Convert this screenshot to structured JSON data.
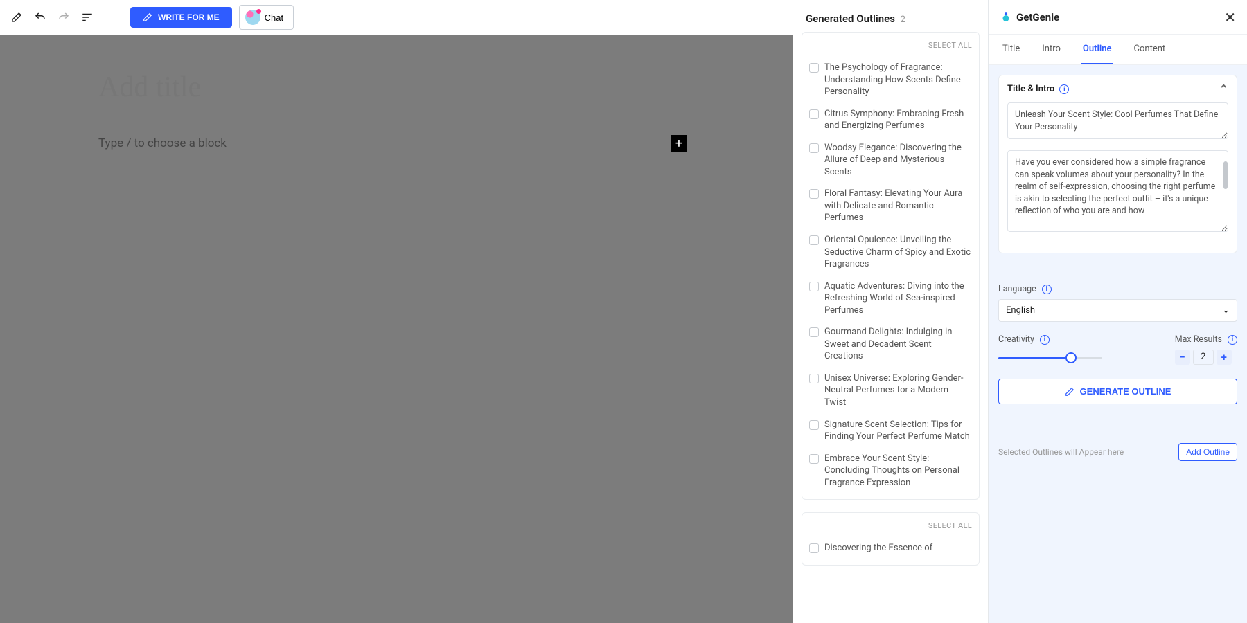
{
  "toolbar": {
    "write_label": "WRITE FOR ME",
    "chat_label": "Chat"
  },
  "editor": {
    "title_placeholder": "Add title",
    "block_placeholder": "Type / to choose a block"
  },
  "outlines_panel": {
    "heading": "Generated Outlines",
    "count": "2",
    "select_all": "SELECT ALL",
    "groups": [
      {
        "items": [
          "The Psychology of Fragrance: Understanding How Scents Define Personality",
          "Citrus Symphony: Embracing Fresh and Energizing Perfumes",
          "Woodsy Elegance: Discovering the Allure of Deep and Mysterious Scents",
          "Floral Fantasy: Elevating Your Aura with Delicate and Romantic Perfumes",
          "Oriental Opulence: Unveiling the Seductive Charm of Spicy and Exotic Fragrances",
          "Aquatic Adventures: Diving into the Refreshing World of Sea-inspired Perfumes",
          "Gourmand Delights: Indulging in Sweet and Decadent Scent Creations",
          "Unisex Universe: Exploring Gender-Neutral Perfumes for a Modern Twist",
          "Signature Scent Selection: Tips for Finding Your Perfect Perfume Match",
          "Embrace Your Scent Style: Concluding Thoughts on Personal Fragrance Expression"
        ]
      },
      {
        "items": [
          "Discovering the Essence of"
        ]
      }
    ]
  },
  "right_panel": {
    "brand": "GetGenie",
    "tabs": [
      "Title",
      "Intro",
      "Outline",
      "Content"
    ],
    "active_tab": "Outline",
    "title_intro": {
      "heading": "Title & Intro",
      "title_value": "Unleash Your Scent Style: Cool Perfumes That Define Your Personality",
      "intro_value": "Have you ever considered how a simple fragrance can speak volumes about your personality? In the realm of self-expression, choosing the right perfume is akin to selecting the perfect outfit – it's a unique reflection of who you are and how"
    },
    "language": {
      "label": "Language",
      "value": "English"
    },
    "creativity": {
      "label": "Creativity"
    },
    "max_results": {
      "label": "Max Results",
      "value": "2"
    },
    "generate_label": "GENERATE OUTLINE",
    "selected_placeholder": "Selected Outlines will Appear here",
    "add_outline_label": "Add Outline"
  }
}
